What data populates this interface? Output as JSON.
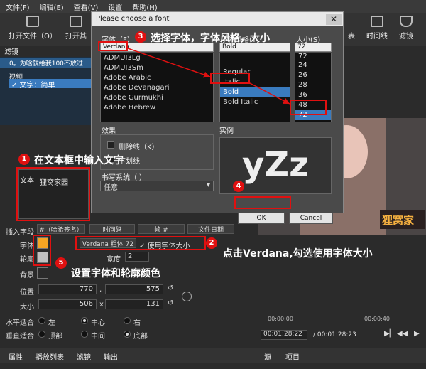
{
  "menu": [
    "文件(F)",
    "编辑(E)",
    "查看(V)",
    "设置",
    "帮助(H)"
  ],
  "toolbar": {
    "open_file": "打开文件（O）",
    "open_other": "打开其",
    "right1": "表",
    "timeline": "时间线",
    "filter": "滤镜"
  },
  "filters_panel": {
    "header": "滤镜",
    "clip_title": "一0。为啥就给我100不放过",
    "video_label": "视频",
    "selected_filter": "✓ 文字：简单"
  },
  "text_props": {
    "text_label": "文本",
    "text_value": "狸窝家园",
    "insert_field": "插入字段",
    "insert_buttons": [
      "#（哈希签名）",
      "时间码",
      "帧 #",
      "文件日期"
    ],
    "font_label": "字体",
    "font_value": "Verdana 粗体 72",
    "use_font_size": "✓ 使用字体大小",
    "outline_label": "轮廓",
    "thickness_label": "宽度",
    "thickness_value": "2",
    "background_label": "背景",
    "position_label": "位置",
    "pos_x": "770",
    "pos_y": "575",
    "size_label": "大小",
    "size_w": "506",
    "size_h": "131",
    "halign_label": "水平适合",
    "halign_options": [
      "左",
      "中心",
      "右"
    ],
    "valign_label": "垂直适合",
    "valign_options": [
      "顶部",
      "中间",
      "底部"
    ],
    "font_color": "#f5a623",
    "outline_color": "#c0c0c0"
  },
  "bottom_tabs": [
    "属性",
    "播放列表",
    "滤镜",
    "输出"
  ],
  "right_tabs": [
    "源",
    "项目"
  ],
  "timeline": {
    "t1": "00:00:00",
    "t2": "00:00:40",
    "current": "00:01:28:22",
    "total": "/ 00:01:28:23"
  },
  "preview": {
    "watermark": "狸窝家"
  },
  "dialog": {
    "title": "Please choose a font",
    "close": "✕",
    "family_label": "字体（F）",
    "family_input": "Verdana",
    "families": [
      "ADMUI3Lg",
      "ADMUI3Sm",
      "Adobe Arabic",
      "Adobe Devanagari",
      "Adobe Gurmukhi",
      "Adobe Hebrew"
    ],
    "style_label": "字体风格(Y)",
    "style_input": "Bold",
    "styles": [
      "Regular",
      "Italic",
      "Bold",
      "Bold Italic"
    ],
    "size_label": "大小(S)",
    "size_input": "72",
    "sizes": [
      "72",
      "24",
      "26",
      "28",
      "36",
      "48",
      "72"
    ],
    "effects_label": "效果",
    "strikeout": "删除线（K）",
    "underline": "下划线",
    "sample_label": "实例",
    "sample_text": "yZz",
    "writing_label": "书写系统（I）",
    "writing_value": "任意",
    "ok": "OK",
    "cancel": "Cancel"
  },
  "annotations": {
    "a1": "在文本框中输入文字",
    "a2": "点击Verdana,勾选使用字体大小",
    "a3": "选择字体，字体风格，大小",
    "a5": "设置字体和轮廓颜色",
    "n1": "1",
    "n2": "2",
    "n3": "3",
    "n4": "4",
    "n5": "5",
    "color": "#e01010"
  }
}
